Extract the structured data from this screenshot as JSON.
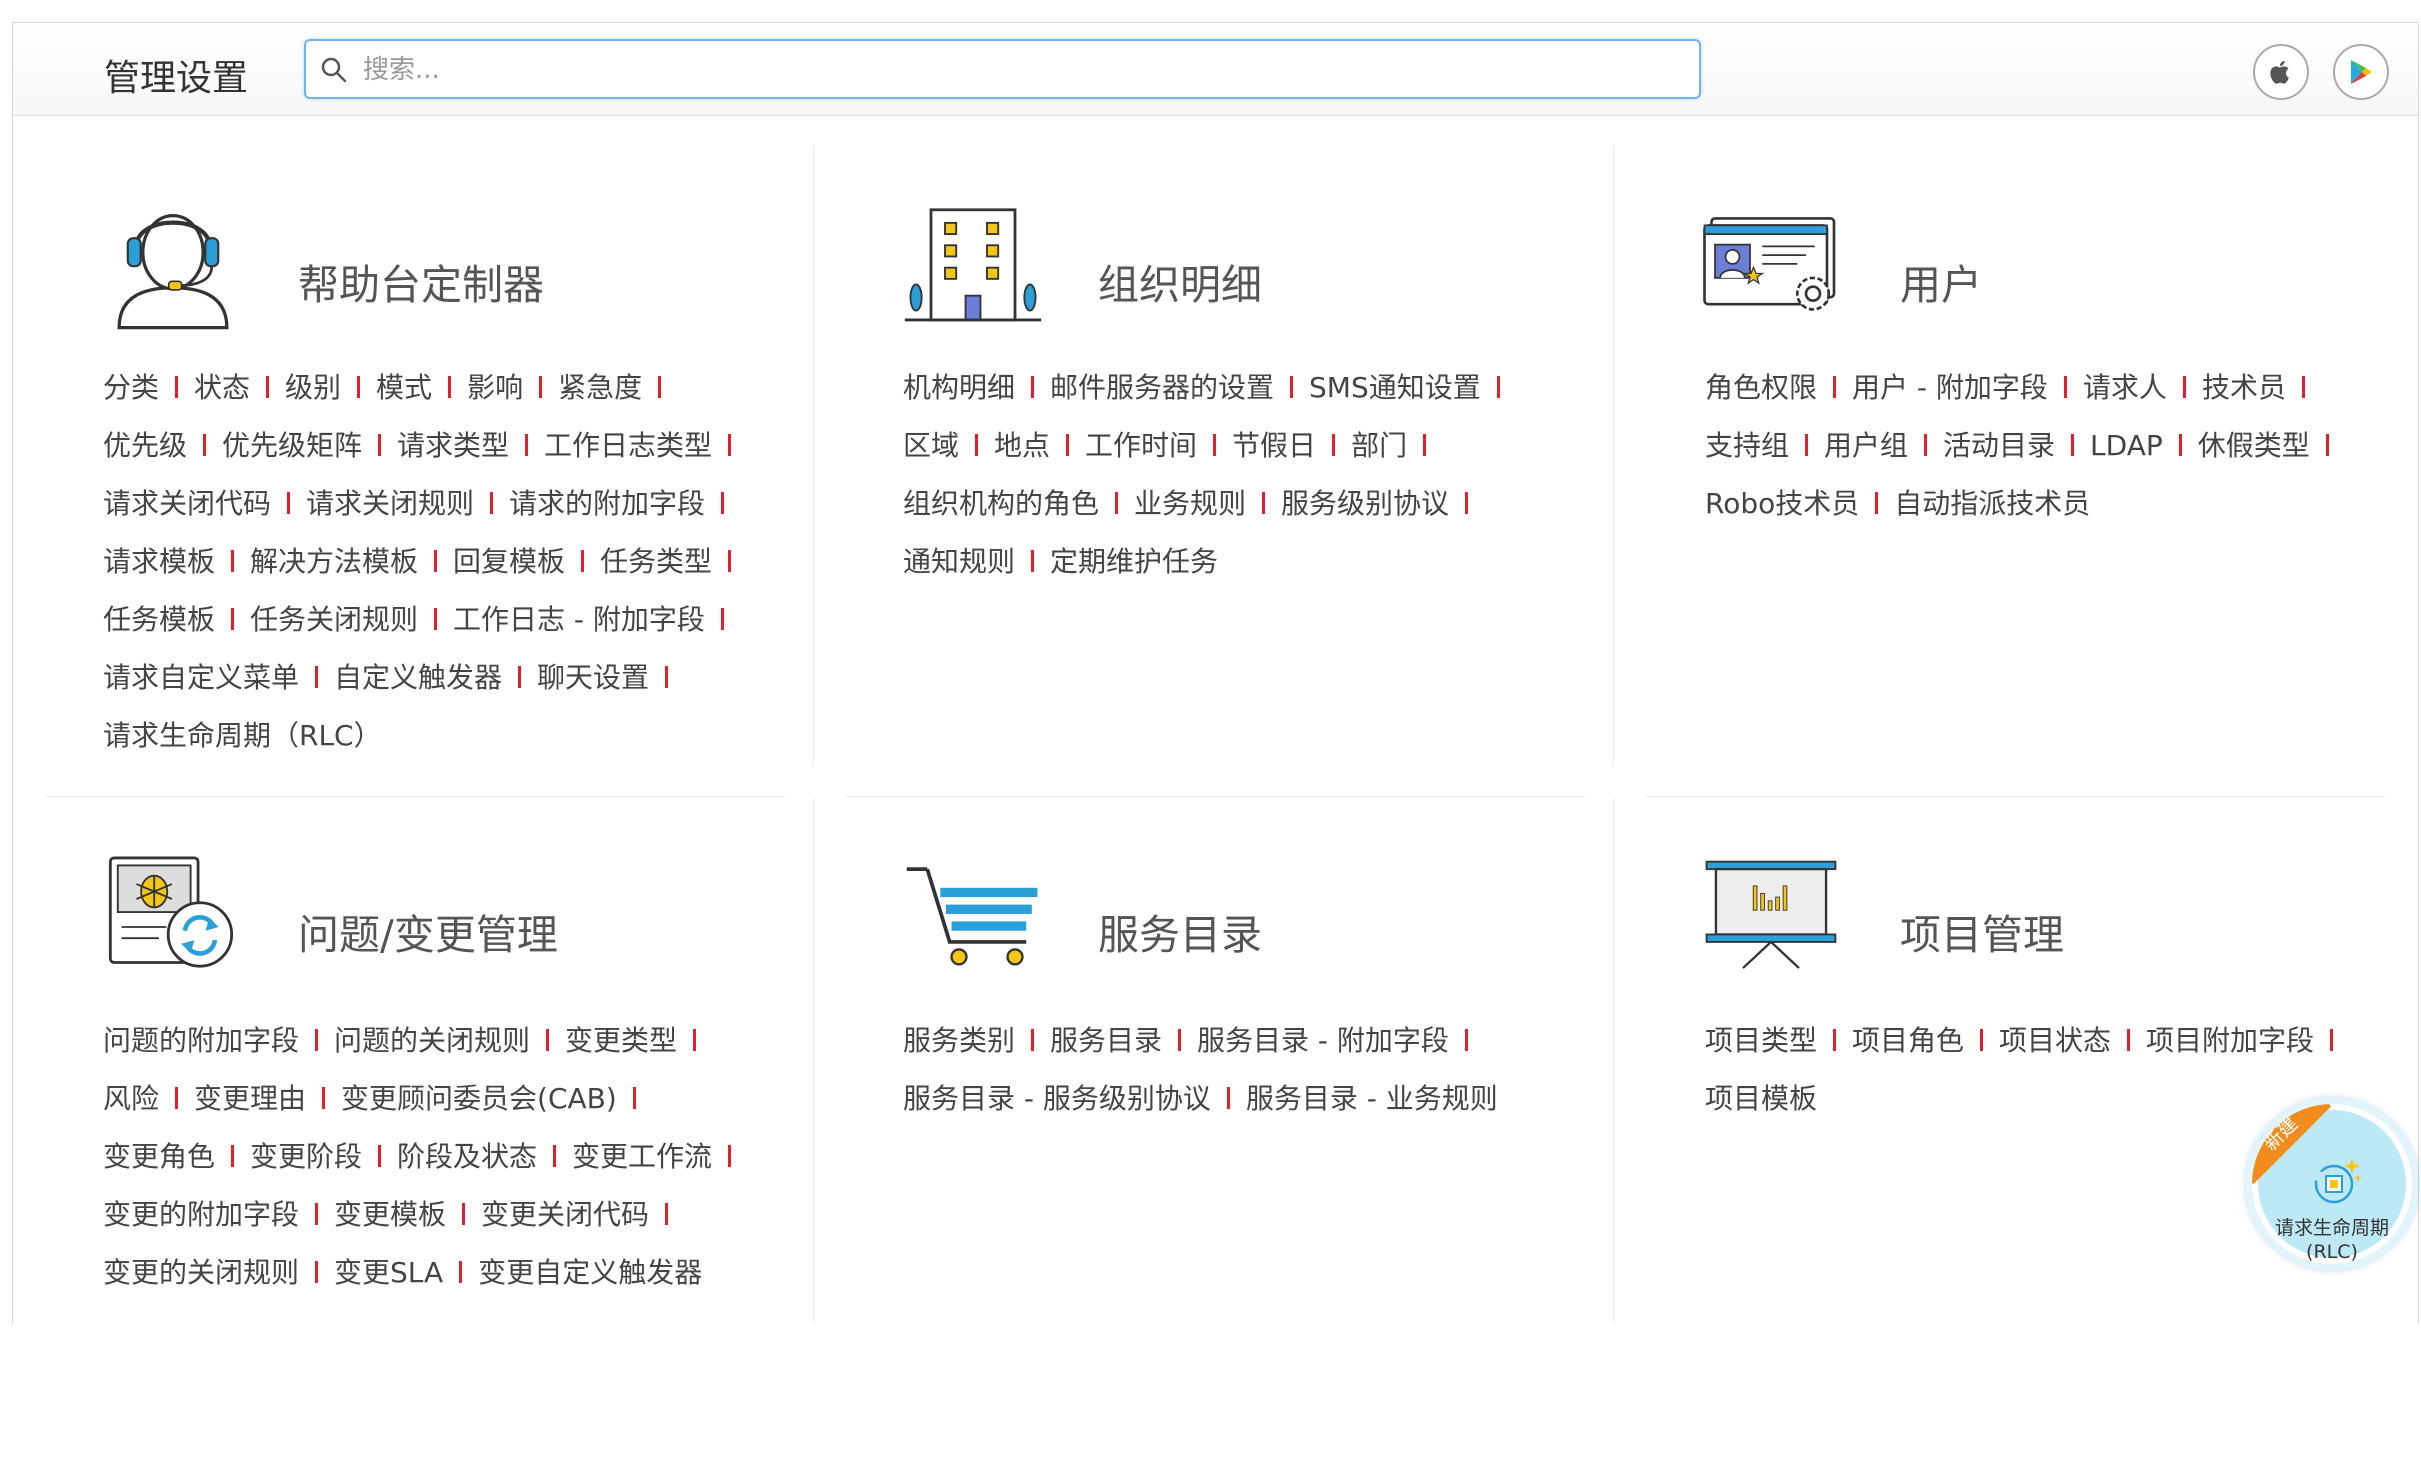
{
  "header": {
    "title": "管理设置",
    "search_placeholder": "搜索...",
    "search_value": ""
  },
  "store_buttons": [
    {
      "icon": "apple-icon"
    },
    {
      "icon": "google-play-icon"
    }
  ],
  "sections": [
    {
      "id": "helpdesk",
      "title": "帮助台定制器",
      "icon": "headset-agent-icon",
      "rows": [
        [
          "分类",
          "状态",
          "级别",
          "模式",
          "影响",
          "紧急度"
        ],
        [
          "优先级",
          "优先级矩阵",
          "请求类型",
          "工作日志类型"
        ],
        [
          "请求关闭代码",
          "请求关闭规则",
          "请求的附加字段"
        ],
        [
          "请求模板",
          "解决方法模板",
          "回复模板",
          "任务类型"
        ],
        [
          "任务模板",
          "任务关闭规则",
          "工作日志 - 附加字段"
        ],
        [
          "请求自定义菜单",
          "自定义触发器",
          "聊天设置"
        ],
        [
          "请求生命周期（RLC）"
        ]
      ]
    },
    {
      "id": "organization",
      "title": "组织明细",
      "icon": "building-icon",
      "rows": [
        [
          "机构明细",
          "邮件服务器的设置",
          "SMS通知设置"
        ],
        [
          "区域",
          "地点",
          "工作时间",
          "节假日",
          "部门"
        ],
        [
          "组织机构的角色",
          "业务规则",
          "服务级别协议"
        ],
        [
          "通知规则",
          "定期维护任务"
        ]
      ]
    },
    {
      "id": "users",
      "title": "用户",
      "icon": "user-card-gear-icon",
      "rows": [
        [
          "角色权限",
          "用户 - 附加字段",
          "请求人",
          "技术员"
        ],
        [
          "支持组",
          "用户组",
          "活动目录",
          "LDAP",
          "休假类型"
        ],
        [
          "Robo技术员",
          "自动指派技术员"
        ]
      ]
    },
    {
      "id": "problem_change",
      "title": "问题/变更管理",
      "icon": "bug-change-icon",
      "rows": [
        [
          "问题的附加字段",
          "问题的关闭规则",
          "变更类型"
        ],
        [
          "风险",
          "变更理由",
          "变更顾问委员会(CAB)"
        ],
        [
          "变更角色",
          "变更阶段",
          "阶段及状态",
          "变更工作流"
        ],
        [
          "变更的附加字段",
          "变更模板",
          "变更关闭代码"
        ],
        [
          "变更的关闭规则",
          "变更SLA",
          "变更自定义触发器"
        ]
      ]
    },
    {
      "id": "service_catalog",
      "title": "服务目录",
      "icon": "shopping-cart-icon",
      "rows": [
        [
          "服务类别",
          "服务目录",
          "服务目录 - 附加字段"
        ],
        [
          "服务目录 - 服务级别协议",
          "服务目录 - 业务规则"
        ]
      ]
    },
    {
      "id": "projects",
      "title": "项目管理",
      "icon": "presentation-board-icon",
      "rows": [
        [
          "项目类型",
          "项目角色",
          "项目状态",
          "项目附加字段"
        ],
        [
          "项目模板"
        ]
      ]
    }
  ],
  "rlc_badge": {
    "ribbon": "新建",
    "label": "请求生命周期",
    "label2": "(RLC)"
  },
  "colors": {
    "separator": "#e0202c",
    "search_border": "#74b4e6",
    "icon_blue": "#2a9fd8",
    "icon_yellow": "#f5c518"
  }
}
